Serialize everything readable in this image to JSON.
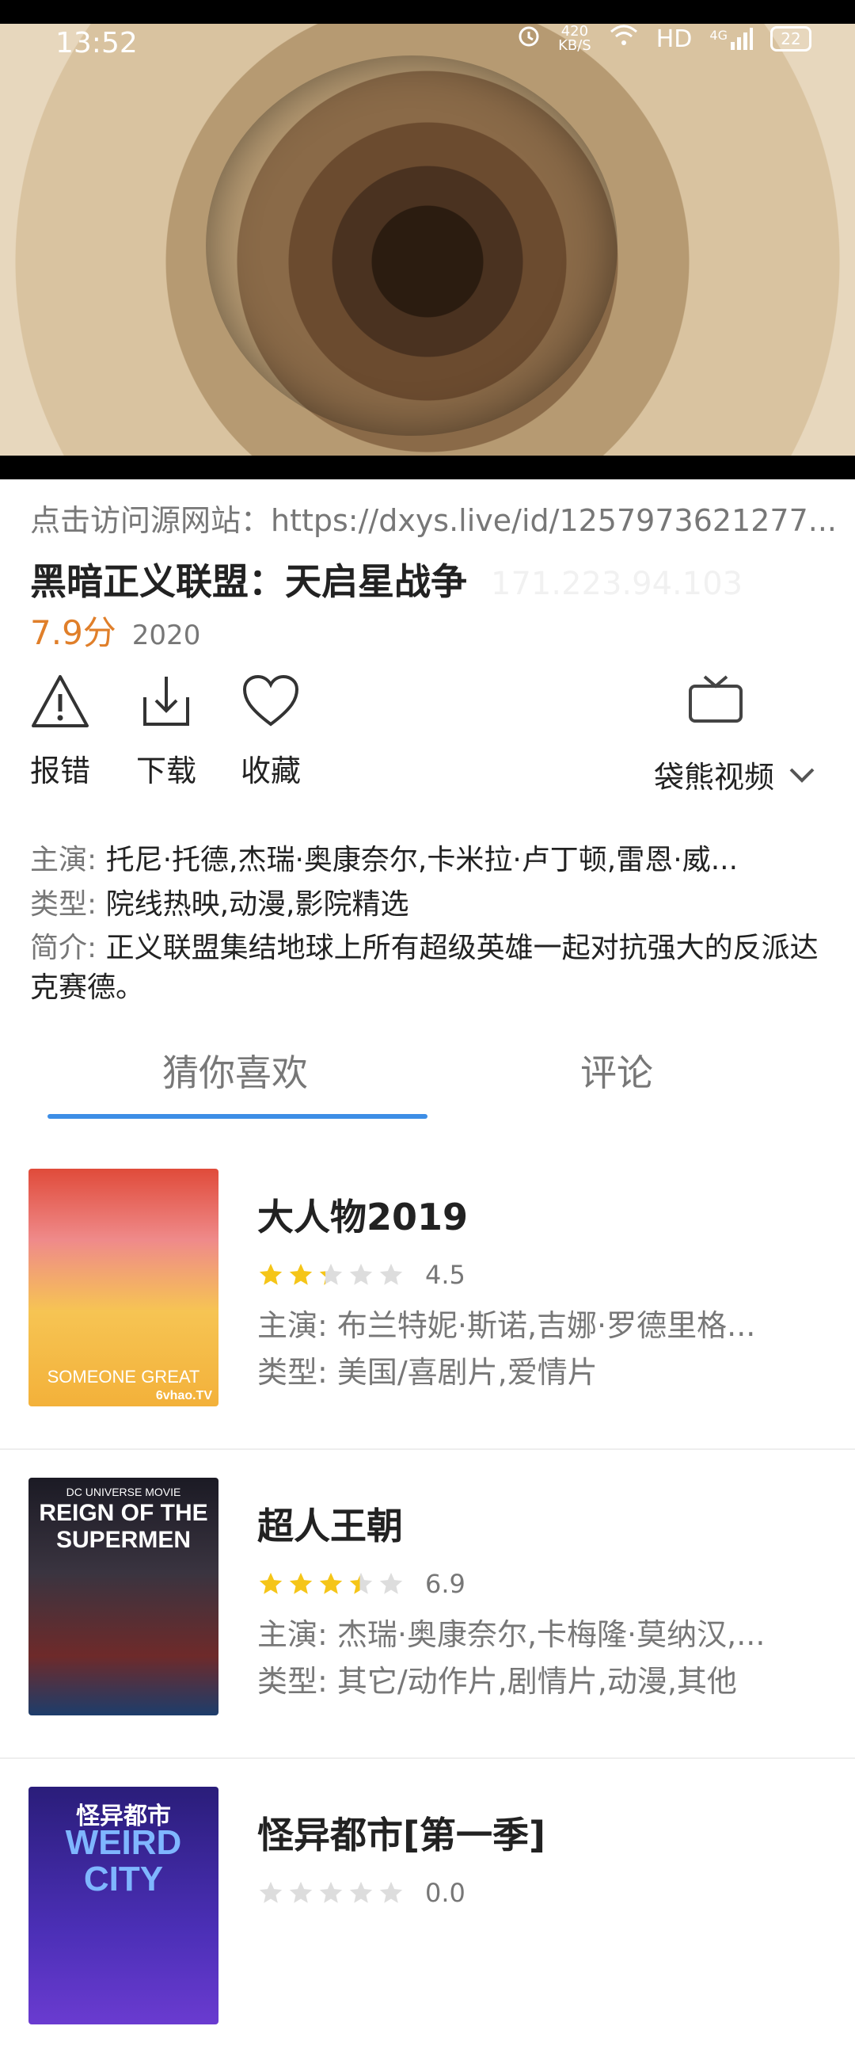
{
  "status": {
    "time": "13:52",
    "net_speed_top": "420",
    "net_speed_unit": "KB/S",
    "hd": "HD",
    "signal": "4G",
    "battery": "22"
  },
  "source_line": "点击访问源网站：https://dxys.live/id/1257973621277...",
  "movie": {
    "title": "黑暗正义联盟：天启星战争",
    "watermark_ip": "171.223.94.103",
    "score": "7.9分",
    "year": "2020"
  },
  "actions": {
    "report": "报错",
    "download": "下载",
    "favorite": "收藏",
    "source_select": "袋熊视频"
  },
  "details": {
    "cast_label": "主演:",
    "cast": "托尼·托德,杰瑞·奥康奈尔,卡米拉·卢丁顿,雷恩·威...",
    "genre_label": "类型:",
    "genre": "院线热映,动漫,影院精选",
    "intro_label": "简介:",
    "intro": "正义联盟集结地球上所有超级英雄一起对抗强大的反派达克赛德。"
  },
  "tabs": {
    "recommend": "猜你喜欢",
    "comments": "评论"
  },
  "recommendations": [
    {
      "title": "大人物2019",
      "rating": "4.5",
      "rating_value": 4.5,
      "cast": "主演: 布兰特妮·斯诺,吉娜·罗德里格...",
      "genre": "类型: 美国/喜剧片,爱情片",
      "poster_text_main": "SOMEONE GREAT",
      "poster_text_site": "6vhao.TV"
    },
    {
      "title": "超人王朝",
      "rating": "6.9",
      "rating_value": 6.9,
      "cast": "主演: 杰瑞·奥康奈尔,卡梅隆·莫纳汉,...",
      "genre": "类型: 其它/动作片,剧情片,动漫,其他",
      "poster_text_main": "REIGN OF THE SUPERMEN",
      "poster_text_site": "DC UNIVERSE MOVIE"
    },
    {
      "title": "怪异都市[第一季]",
      "rating": "0.0",
      "rating_value": 0,
      "cast": "",
      "genre": "",
      "poster_text_main": "WEIRD CITY",
      "poster_text_site": "怪异都市"
    }
  ],
  "colors": {
    "accent_blue": "#3d8ee6",
    "score_orange": "#e07f2a",
    "star_gold": "#f5c518",
    "star_gray": "#dddddd"
  }
}
